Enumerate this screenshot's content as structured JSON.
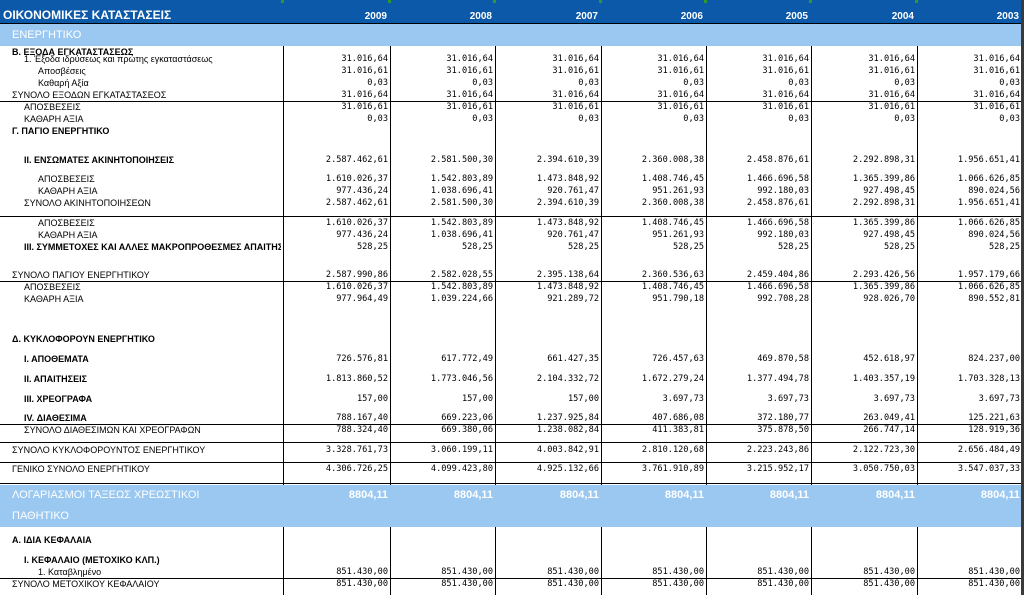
{
  "sheet": {
    "title": "ΟΙΚΟΝΟΜΙΚΕΣ ΚΑΤΑΣΤΑΣΕΙΣ",
    "years": [
      "2009",
      "2008",
      "2007",
      "2006",
      "2005",
      "2004",
      "2003"
    ],
    "colors": {
      "header_bg": "#0c58a9",
      "band_bg": "#9ac8f0",
      "grid": "#000000",
      "header_text": "#ffffff"
    },
    "rows": [
      {
        "type": "band",
        "label": "ΕΝΕΡΓΗΤΙΚΟ"
      },
      {
        "type": "data",
        "label": "Β. ΕΞΟΔΑ ΕΓΚΑΤΑΣΤΑΣΕΩΣ",
        "indent": 0,
        "bold": true,
        "values": [
          "",
          "",
          "",
          "",
          "",
          "",
          ""
        ]
      },
      {
        "type": "data",
        "label": "1. Έξοδα ιδρύσεως και πρώτης εγκαταστάσεως",
        "indent": 1,
        "bold": false,
        "values": [
          "31.016,64",
          "31.016,64",
          "31.016,64",
          "31.016,64",
          "31.016,64",
          "31.016,64",
          "31.016,64"
        ]
      },
      {
        "type": "data",
        "label": "Αποσβέσεις",
        "indent": 2,
        "bold": false,
        "values": [
          "31.016,61",
          "31.016,61",
          "31.016,61",
          "31.016,61",
          "31.016,61",
          "31.016,61",
          "31.016,61"
        ]
      },
      {
        "type": "data",
        "label": "Καθαρή Αξία",
        "indent": 2,
        "bold": false,
        "values": [
          "0,03",
          "0,03",
          "0,03",
          "0,03",
          "0,03",
          "0,03",
          "0,03"
        ]
      },
      {
        "type": "data",
        "label": "ΣΥΝΟΛΟ ΕΞΟΔΩΝ ΕΓΚΑΤΑΣΤΑΣΕΟΣ",
        "indent": 0,
        "bold": false,
        "values": [
          "31.016,64",
          "31.016,64",
          "31.016,64",
          "31.016,64",
          "31.016,64",
          "31.016,64",
          "31.016,64"
        ]
      },
      {
        "type": "data",
        "label": "ΑΠΟΣΒΕΣΕΙΣ",
        "indent": 1,
        "bold": false,
        "values": [
          "31.016,61",
          "31.016,61",
          "31.016,61",
          "31.016,61",
          "31.016,61",
          "31.016,61",
          "31.016,61"
        ]
      },
      {
        "type": "data",
        "label": "ΚΑΘΑΡΗ ΑΞΙΑ",
        "indent": 1,
        "bold": false,
        "values": [
          "0,03",
          "0,03",
          "0,03",
          "0,03",
          "0,03",
          "0,03",
          "0,03"
        ]
      },
      {
        "type": "data",
        "label": "Γ. ΠΑΓΙΟ ΕΝΕΡΓΗΤΙΚΟ",
        "indent": 0,
        "bold": true,
        "values": [
          "",
          "",
          "",
          "",
          "",
          "",
          ""
        ]
      },
      {
        "type": "data",
        "label": "ΙΙ. ΕΝΣΩΜΑΤΕΣ ΑΚΙΝΗΤΟΠΟΙΗΣΕΙΣ",
        "indent": 1,
        "bold": true,
        "values": [
          "2.587.462,61",
          "2.581.500,30",
          "2.394.610,39",
          "2.360.008,38",
          "2.458.876,61",
          "2.292.898,31",
          "1.956.651,41"
        ]
      },
      {
        "type": "data",
        "label": "ΑΠΟΣΒΕΣΕΙΣ",
        "indent": 2,
        "bold": false,
        "values": [
          "1.610.026,37",
          "1.542.803,89",
          "1.473.848,92",
          "1.408.746,45",
          "1.466.696,58",
          "1.365.399,86",
          "1.066.626,85"
        ]
      },
      {
        "type": "data",
        "label": "ΚΑΘΑΡΗ ΑΞΙΑ",
        "indent": 2,
        "bold": false,
        "values": [
          "977.436,24",
          "1.038.696,41",
          "920.761,47",
          "951.261,93",
          "992.180,03",
          "927.498,45",
          "890.024,56"
        ]
      },
      {
        "type": "data",
        "label": "ΣΥΝΟΛΟ ΑΚΙΝΗΤΟΠΟΙΗΣΕΩΝ",
        "indent": 1,
        "bold": false,
        "values": [
          "2.587.462,61",
          "2.581.500,30",
          "2.394.610,39",
          "2.360.008,38",
          "2.458.876,61",
          "2.292.898,31",
          "1.956.651,41"
        ]
      },
      {
        "type": "data",
        "label": "ΑΠΟΣΒΕΣΕΙΣ",
        "indent": 2,
        "bold": false,
        "values": [
          "1.610.026,37",
          "1.542.803,89",
          "1.473.848,92",
          "1.408.746,45",
          "1.466.696,58",
          "1.365.399,86",
          "1.066.626,85"
        ]
      },
      {
        "type": "data",
        "label": "ΚΑΘΑΡΗ ΑΞΙΑ",
        "indent": 2,
        "bold": false,
        "values": [
          "977.436,24",
          "1.038.696,41",
          "920.761,47",
          "951.261,93",
          "992.180,03",
          "927.498,45",
          "890.024,56"
        ]
      },
      {
        "type": "data",
        "label": "ΙΙΙ. ΣΥΜΜΕΤΟΧΕΣ ΚΑΙ ΑΛΛΕΣ ΜΑΚΡΟΠΡΟΘΕΣΜΕΣ ΑΠΑΙΤΗΣΕΙΣ",
        "indent": 1,
        "bold": true,
        "values": [
          "528,25",
          "528,25",
          "528,25",
          "528,25",
          "528,25",
          "528,25",
          "528,25"
        ]
      },
      {
        "type": "data",
        "label": "ΣΥΝΟΛΟ ΠΑΓΙΟΥ ΕΝΕΡΓΗΤΙΚΟΥ",
        "indent": 0,
        "bold": false,
        "values": [
          "2.587.990,86",
          "2.582.028,55",
          "2.395.138,64",
          "2.360.536,63",
          "2.459.404,86",
          "2.293.426,56",
          "1.957.179,66"
        ]
      },
      {
        "type": "data",
        "label": "ΑΠΟΣΒΕΣΕΙΣ",
        "indent": 1,
        "bold": false,
        "values": [
          "1.610.026,37",
          "1.542.803,89",
          "1.473.848,92",
          "1.408.746,45",
          "1.466.696,58",
          "1.365.399,86",
          "1.066.626,85"
        ]
      },
      {
        "type": "data",
        "label": "ΚΑΘΑΡΗ ΑΞΙΑ",
        "indent": 1,
        "bold": false,
        "values": [
          "977.964,49",
          "1.039.224,66",
          "921.289,72",
          "951.790,18",
          "992.708,28",
          "928.026,70",
          "890.552,81"
        ]
      },
      {
        "type": "data",
        "label": "Δ. ΚΥΚΛΟΦΟΡΟΥΝ ΕΝΕΡΓΗΤΙΚΟ",
        "indent": 0,
        "bold": true,
        "values": [
          "",
          "",
          "",
          "",
          "",
          "",
          ""
        ]
      },
      {
        "type": "data",
        "label": "Ι. ΑΠΟΘΕΜΑΤΑ",
        "indent": 1,
        "bold": true,
        "values": [
          "726.576,81",
          "617.772,49",
          "661.427,35",
          "726.457,63",
          "469.870,58",
          "452.618,97",
          "824.237,00"
        ]
      },
      {
        "type": "data",
        "label": "ΙΙ. ΑΠΑΙΤΗΣΕΙΣ",
        "indent": 1,
        "bold": true,
        "values": [
          "1.813.860,52",
          "1.773.046,56",
          "2.104.332,72",
          "1.672.279,24",
          "1.377.494,78",
          "1.403.357,19",
          "1.703.328,13"
        ]
      },
      {
        "type": "data",
        "label": "ΙΙΙ. ΧΡΕΟΓΡΑΦΑ",
        "indent": 1,
        "bold": true,
        "values": [
          "157,00",
          "157,00",
          "157,00",
          "3.697,73",
          "3.697,73",
          "3.697,73",
          "3.697,73"
        ]
      },
      {
        "type": "data",
        "label": "IV. ΔΙΑΘΕΣΙΜΑ",
        "indent": 1,
        "bold": true,
        "values": [
          "788.167,40",
          "669.223,06",
          "1.237.925,84",
          "407.686,08",
          "372.180,77",
          "263.049,41",
          "125.221,63"
        ]
      },
      {
        "type": "data",
        "label": "ΣΥΝΟΛΟ ΔΙΑΘΕΣΙΜΩΝ ΚΑΙ ΧΡΕΟΓΡΑΦΩΝ",
        "indent": 1,
        "bold": false,
        "values": [
          "788.324,40",
          "669.380,06",
          "1.238.082,84",
          "411.383,81",
          "375.878,50",
          "266.747,14",
          "128.919,36"
        ]
      },
      {
        "type": "data",
        "label": "ΣΥΝΟΛΟ ΚΥΚΛΟΦΟΡΟΥΝΤΟΣ ΕΝΕΡΓΗΤΙΚΟΥ",
        "indent": 0,
        "bold": false,
        "values": [
          "3.328.761,73",
          "3.060.199,11",
          "4.003.842,91",
          "2.810.120,68",
          "2.223.243,86",
          "2.122.723,30",
          "2.656.484,49"
        ]
      },
      {
        "type": "data",
        "label": "ΓΕΝΙΚΟ ΣΥΝΟΛΟ ΕΝΕΡΓΗΤΙΚΟΥ",
        "indent": 0,
        "bold": false,
        "values": [
          "4.306.726,25",
          "4.099.423,80",
          "4.925.132,66",
          "3.761.910,89",
          "3.215.952,17",
          "3.050.750,03",
          "3.547.037,33"
        ]
      },
      {
        "type": "band",
        "label": "ΛΟΓΑΡΙΑΣΜΟΙ ΤΑΞΕΩΣ ΧΡΕΩΣΤΙΚΟΙ",
        "values": [
          "8804,11",
          "8804,11",
          "8804,11",
          "8804,11",
          "8804,11",
          "8804,11",
          "8804,11"
        ]
      },
      {
        "type": "band",
        "label": "ΠΑΘΗΤΙΚΟ"
      },
      {
        "type": "data",
        "label": "Α. ΙΔΙΑ ΚΕΦΑΛΑΙΑ",
        "indent": 0,
        "bold": true,
        "values": [
          "",
          "",
          "",
          "",
          "",
          "",
          ""
        ]
      },
      {
        "type": "data",
        "label": "Ι. ΚΕΦΑΛΑΙΟ (ΜΕΤΟΧΙΚΟ ΚΛΠ.)",
        "indent": 1,
        "bold": true,
        "values": [
          "",
          "",
          "",
          "",
          "",
          "",
          ""
        ]
      },
      {
        "type": "data",
        "label": "1. Καταβλημένο",
        "indent": 2,
        "bold": false,
        "values": [
          "851.430,00",
          "851.430,00",
          "851.430,00",
          "851.430,00",
          "851.430,00",
          "851.430,00",
          "851.430,00"
        ]
      },
      {
        "type": "data",
        "label": "ΣΥΝΟΛΟ ΜΕΤΟΧΙΚΟΥ ΚΕΦΑΛΑΙΟΥ",
        "indent": 0,
        "bold": false,
        "values": [
          "851.430,00",
          "851.430,00",
          "851.430,00",
          "851.430,00",
          "851.430,00",
          "851.430,00",
          "851.430,00"
        ]
      }
    ]
  }
}
